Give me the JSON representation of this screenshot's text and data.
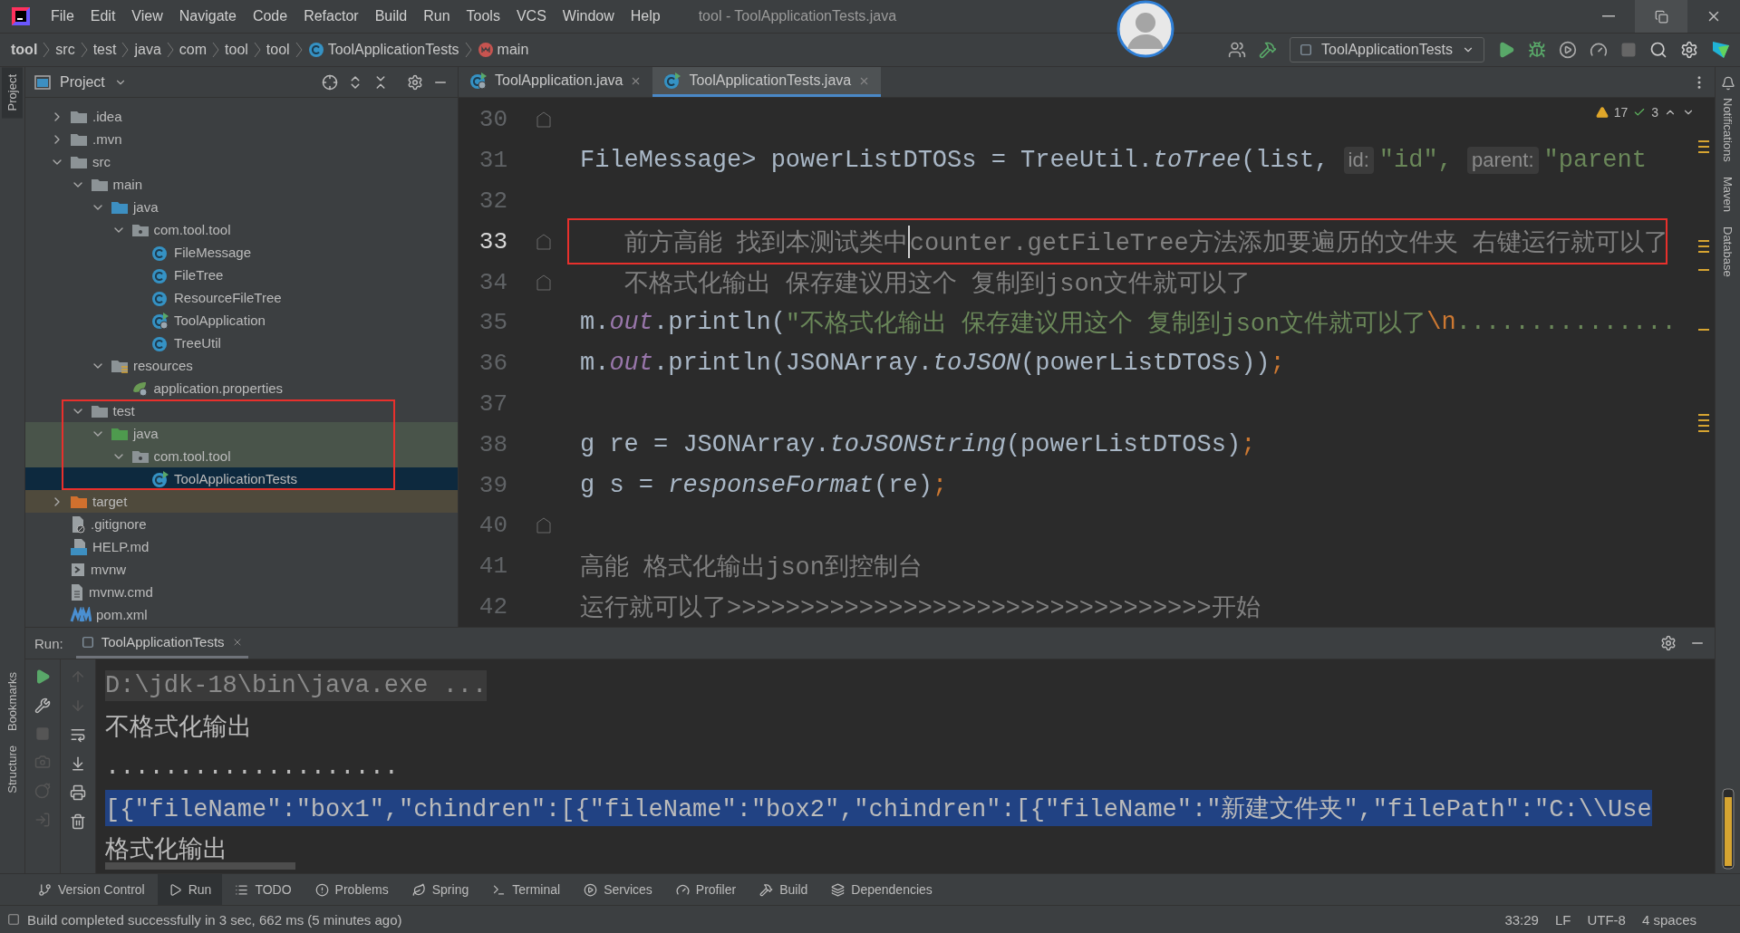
{
  "menu_bar": {
    "items": [
      "File",
      "Edit",
      "View",
      "Navigate",
      "Code",
      "Refactor",
      "Build",
      "Run",
      "Tools",
      "VCS",
      "Window",
      "Help"
    ],
    "title": "tool - ToolApplicationTests.java"
  },
  "breadcrumbs": [
    {
      "label": "tool",
      "kind": "project"
    },
    {
      "label": "src",
      "kind": "dir"
    },
    {
      "label": "test",
      "kind": "dir"
    },
    {
      "label": "java",
      "kind": "dir"
    },
    {
      "label": "com",
      "kind": "dir"
    },
    {
      "label": "tool",
      "kind": "dir"
    },
    {
      "label": "tool",
      "kind": "dir"
    },
    {
      "label": "ToolApplicationTests",
      "kind": "class"
    },
    {
      "label": "main",
      "kind": "method"
    }
  ],
  "run_configuration": "ToolApplicationTests",
  "left_tool_windows": [
    {
      "label": "Project",
      "selected": true
    },
    {
      "label": "Bookmarks",
      "selected": false
    },
    {
      "label": "Structure",
      "selected": false
    }
  ],
  "right_tool_windows": [
    "Notifications",
    "Maven",
    "Database"
  ],
  "project_panel": {
    "title": "Project",
    "tree": [
      {
        "label": ".idea",
        "kind": "folder",
        "expanded": false,
        "selected": false
      },
      {
        "label": ".mvn",
        "kind": "folder",
        "expanded": false,
        "selected": false
      },
      {
        "label": "src",
        "kind": "folder",
        "expanded": true,
        "selected": false,
        "children": [
          {
            "label": "main",
            "kind": "folder",
            "expanded": true,
            "selected": false,
            "children": [
              {
                "label": "java",
                "kind": "source-folder",
                "expanded": true,
                "selected": false,
                "children": [
                  {
                    "label": "com.tool.tool",
                    "kind": "package",
                    "expanded": true,
                    "selected": false,
                    "children": [
                      {
                        "label": "FileMessage",
                        "kind": "class",
                        "selected": false
                      },
                      {
                        "label": "FileTree",
                        "kind": "class",
                        "selected": false
                      },
                      {
                        "label": "ResourceFileTree",
                        "kind": "class",
                        "selected": false
                      },
                      {
                        "label": "ToolApplication",
                        "kind": "app-class",
                        "selected": false
                      },
                      {
                        "label": "TreeUtil",
                        "kind": "class",
                        "selected": false
                      }
                    ]
                  }
                ]
              },
              {
                "label": "resources",
                "kind": "resources-folder",
                "expanded": true,
                "selected": false,
                "children": [
                  {
                    "label": "application.properties",
                    "kind": "properties",
                    "selected": false
                  }
                ]
              }
            ]
          },
          {
            "label": "test",
            "kind": "folder",
            "expanded": true,
            "selected": false,
            "annotated": true,
            "children": [
              {
                "label": "java",
                "kind": "test-folder",
                "expanded": true,
                "selected": false,
                "test_source": true,
                "children": [
                  {
                    "label": "com.tool.tool",
                    "kind": "package",
                    "expanded": true,
                    "selected": false,
                    "test_source": true,
                    "children": [
                      {
                        "label": "ToolApplicationTests",
                        "kind": "test-class",
                        "selected": true
                      }
                    ]
                  }
                ]
              }
            ]
          }
        ]
      },
      {
        "label": "target",
        "kind": "excluded-folder",
        "expanded": false,
        "selected": false,
        "excluded": true
      },
      {
        "label": ".gitignore",
        "kind": "ignore-file",
        "selected": false
      },
      {
        "label": "HELP.md",
        "kind": "markdown",
        "selected": false
      },
      {
        "label": "mvnw",
        "kind": "script",
        "selected": false
      },
      {
        "label": "mvnw.cmd",
        "kind": "text-file",
        "selected": false
      },
      {
        "label": "pom.xml",
        "kind": "maven",
        "selected": false
      }
    ]
  },
  "editor": {
    "tabs": [
      {
        "label": "ToolApplication.java",
        "selected": false,
        "kind": "app-class"
      },
      {
        "label": "ToolApplicationTests.java",
        "selected": true,
        "kind": "test-class"
      }
    ],
    "warnings": "17",
    "checks": "3",
    "lines": [
      {
        "number": "30",
        "current": false,
        "fold": true
      },
      {
        "number": "31",
        "current": false,
        "fold": false,
        "tokens": [
          {
            "text": "FileMessage> powerListDTOSs = TreeUtil.",
            "kind": "plain"
          },
          {
            "text": "toTree",
            "kind": "method"
          },
          {
            "text": "(list, ",
            "kind": "plain"
          },
          {
            "text": "id:",
            "kind": "hint"
          },
          {
            "text": "\"id\", ",
            "kind": "string"
          },
          {
            "text": "parent:",
            "kind": "hint"
          },
          {
            "text": "\"parent",
            "kind": "string"
          }
        ]
      },
      {
        "number": "32",
        "current": false,
        "fold": false
      },
      {
        "number": "33",
        "current": true,
        "fold": true,
        "annotated": true,
        "tokens": [
          {
            "text": "   前方高能 找到本测试类中",
            "kind": "comment"
          },
          {
            "text": "counter.getFileTree方法添加要遍历的文件夹 右键运行就可以了",
            "kind": "comment",
            "caret": true
          }
        ]
      },
      {
        "number": "34",
        "current": false,
        "fold": true,
        "tokens": [
          {
            "text": "   不格式化输出 保存建议用这个 复制到json文件就可以了",
            "kind": "comment"
          }
        ]
      },
      {
        "number": "35",
        "current": false,
        "fold": false,
        "tokens": [
          {
            "text": "m.",
            "kind": "plain"
          },
          {
            "text": "out",
            "kind": "field"
          },
          {
            "text": ".println(",
            "kind": "plain"
          },
          {
            "text": "\"不格式化输出 保存建议用这个 复制到json文件就可以了",
            "kind": "string"
          },
          {
            "text": "\\n",
            "kind": "keyword"
          },
          {
            "text": "...............",
            "kind": "string"
          }
        ]
      },
      {
        "number": "36",
        "current": false,
        "fold": false,
        "tokens": [
          {
            "text": "m.",
            "kind": "plain"
          },
          {
            "text": "out",
            "kind": "field"
          },
          {
            "text": ".println(JSONArray.",
            "kind": "plain"
          },
          {
            "text": "toJSON",
            "kind": "method"
          },
          {
            "text": "(powerListDTOSs))",
            "kind": "plain"
          },
          {
            "text": ";",
            "kind": "keyword"
          }
        ]
      },
      {
        "number": "37",
        "current": false,
        "fold": false
      },
      {
        "number": "38",
        "current": false,
        "fold": false,
        "tokens": [
          {
            "text": "g re = JSONArray.",
            "kind": "plain"
          },
          {
            "text": "toJSONString",
            "kind": "method"
          },
          {
            "text": "(powerListDTOSs)",
            "kind": "plain"
          },
          {
            "text": ";",
            "kind": "keyword"
          }
        ]
      },
      {
        "number": "39",
        "current": false,
        "fold": false,
        "tokens": [
          {
            "text": "g s = ",
            "kind": "plain"
          },
          {
            "text": "responseFormat",
            "kind": "method"
          },
          {
            "text": "(re)",
            "kind": "plain"
          },
          {
            "text": ";",
            "kind": "keyword"
          }
        ]
      },
      {
        "number": "40",
        "current": false,
        "fold": true
      },
      {
        "number": "41",
        "current": false,
        "fold": false,
        "tokens": [
          {
            "text": "高能 格式化输出json到控制台",
            "kind": "comment"
          }
        ]
      },
      {
        "number": "42",
        "current": false,
        "fold": false,
        "tokens": [
          {
            "text": "运行就可以了>>>>>>>>>>>>>>>>>>>>>>>>>>>>>>>>>开始",
            "kind": "comment"
          }
        ]
      }
    ]
  },
  "run_panel": {
    "label": "Run:",
    "tab": "ToolApplicationTests",
    "console": [
      {
        "text": "D:\\jdk-18\\bin\\java.exe ...",
        "kind": "command"
      },
      {
        "text": "不格式化输出",
        "kind": "output"
      },
      {
        "text": "....................",
        "kind": "output"
      },
      {
        "text": "[{\"fileName\":\"box1\",\"chindren\":[{\"fileName\":\"box2\",\"chindren\":[{\"fileName\":\"新建文件夹\",\"filePath\":\"C:\\\\Use",
        "kind": "selected"
      },
      {
        "text": "格式化输出",
        "kind": "output"
      }
    ]
  },
  "tool_tabs": [
    {
      "label": "Version Control",
      "selected": false
    },
    {
      "label": "Run",
      "selected": true
    },
    {
      "label": "TODO",
      "selected": false
    },
    {
      "label": "Problems",
      "selected": false
    },
    {
      "label": "Spring",
      "selected": false
    },
    {
      "label": "Terminal",
      "selected": false
    },
    {
      "label": "Services",
      "selected": false
    },
    {
      "label": "Profiler",
      "selected": false
    },
    {
      "label": "Build",
      "selected": false
    },
    {
      "label": "Dependencies",
      "selected": false
    }
  ],
  "status_bar": {
    "message": "Build completed successfully in 3 sec, 662 ms (5 minutes ago)",
    "items": [
      "33:29",
      "LF",
      "UTF-8",
      "4 spaces"
    ]
  }
}
